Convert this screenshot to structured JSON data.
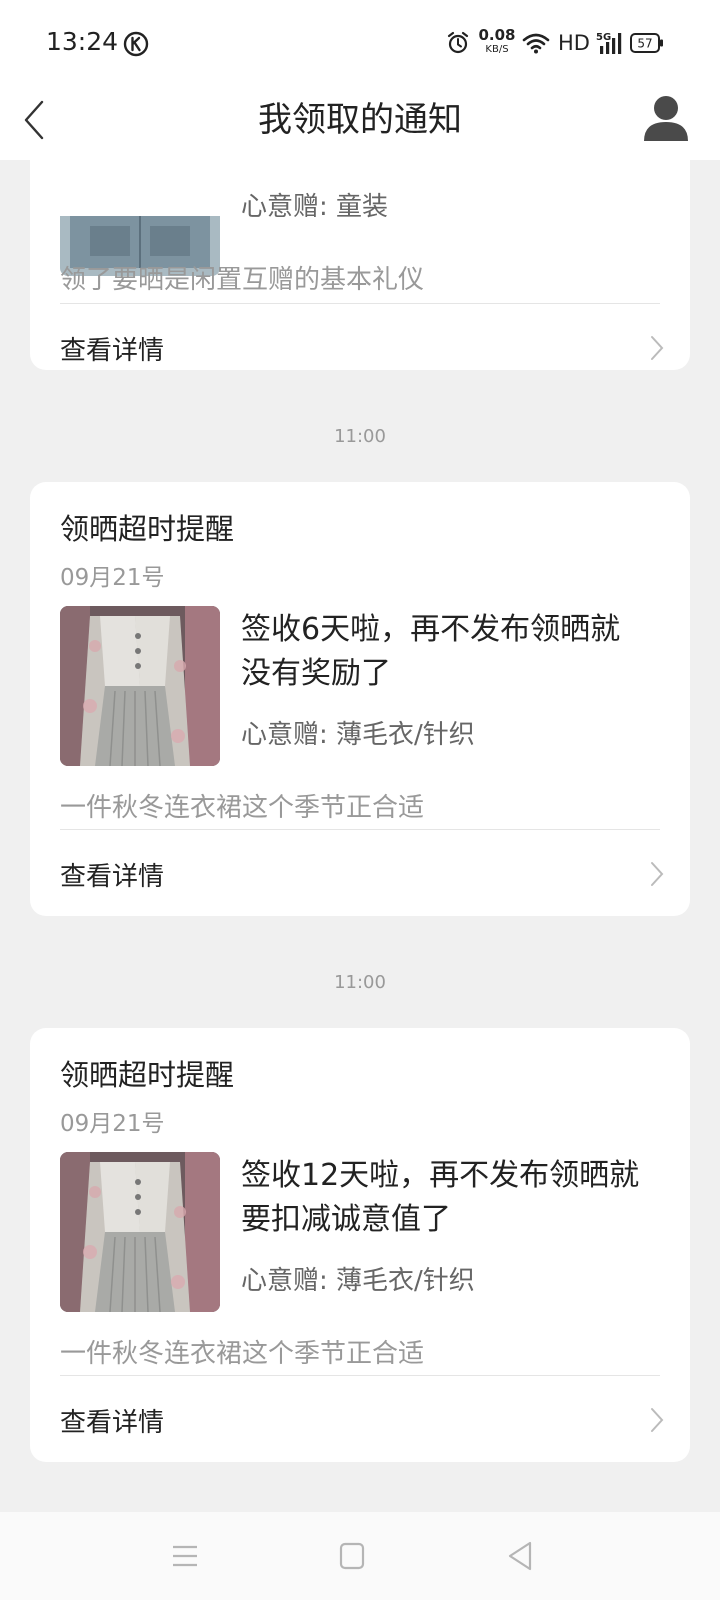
{
  "status_bar": {
    "time": "13:24",
    "net_speed": "0.08",
    "net_unit": "KB/S",
    "hd": "HD",
    "signal": "5G",
    "battery": "57"
  },
  "header": {
    "title": "我领取的通知"
  },
  "cards": [
    {
      "partial": true,
      "gift": "心意赠: 童装",
      "description": "领了要晒是闲置互赠的基本礼仪",
      "detail_label": "查看详情"
    },
    {
      "time_label": "11:00",
      "title": "领晒超时提醒",
      "date": "09月21号",
      "message_line1": "签收6天啦，再不发布领晒就",
      "message_line2": "没有奖励了",
      "gift": "心意赠: 薄毛衣/针织",
      "description": "一件秋冬连衣裙这个季节正合适",
      "detail_label": "查看详情"
    },
    {
      "time_label": "11:00",
      "title": "领晒超时提醒",
      "date": "09月21号",
      "message_line1": "签收12天啦，再不发布领晒就",
      "message_line2": "要扣减诚意值了",
      "gift": "心意赠: 薄毛衣/针织",
      "description": "一件秋冬连衣裙这个季节正合适",
      "detail_label": "查看详情"
    }
  ],
  "icons": {
    "back": "back-arrow-icon",
    "avatar": "user-avatar-icon",
    "chevron": "chevron-right-icon",
    "nav_menu": "menu-icon",
    "nav_home": "home-square-icon",
    "nav_back": "back-triangle-icon"
  },
  "colors": {
    "page_bg": "#f0f0f0",
    "card_bg": "#ffffff",
    "text_primary": "#222222",
    "text_secondary": "#999999",
    "text_gift": "#666666"
  }
}
